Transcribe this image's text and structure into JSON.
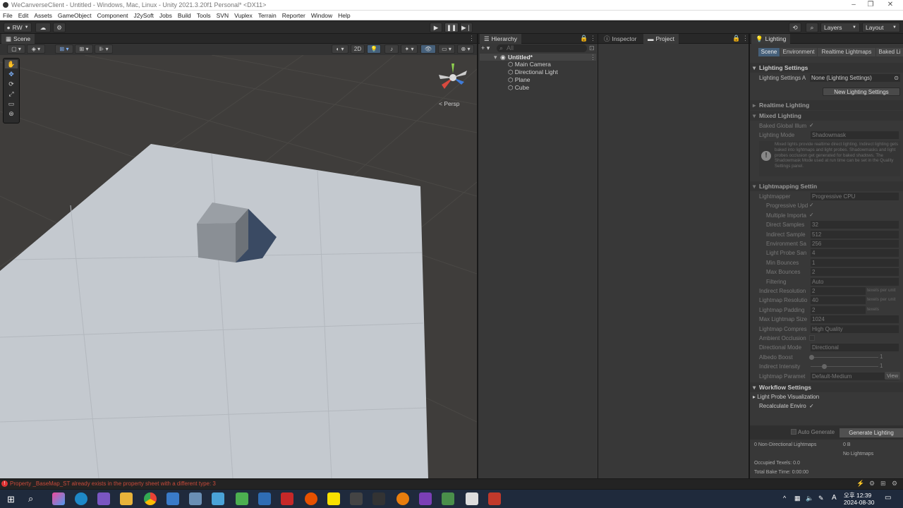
{
  "window": {
    "title": "WeCanverseClient - Untitled - Windows, Mac, Linux - Unity 2021.3.20f1 Personal* <DX11>"
  },
  "menu": [
    "File",
    "Edit",
    "Assets",
    "GameObject",
    "Component",
    "J2ySoft",
    "Jobs",
    "Build",
    "Tools",
    "SVN",
    "Vuplex",
    "Terrain",
    "Reporter",
    "Window",
    "Help"
  ],
  "toolbar": {
    "account": "RW",
    "layers": "Layers",
    "layout": "Layout"
  },
  "scene": {
    "tab": "Scene",
    "btn_2d": "2D",
    "persp": "Persp"
  },
  "hierarchy": {
    "tab": "Hierarchy",
    "search_placeholder": "All",
    "root": "Untitled*",
    "items": [
      "Main Camera",
      "Directional Light",
      "Plane",
      "Cube"
    ]
  },
  "inspector": {
    "tab": "Inspector",
    "project_tab": "Project"
  },
  "lighting": {
    "tab": "Lighting",
    "subtabs": [
      "Scene",
      "Environment",
      "Realtime Lightmaps",
      "Baked Li"
    ],
    "lighting_settings_header": "Lighting Settings",
    "lighting_settings_asset_label": "Lighting Settings A",
    "lighting_settings_asset_value": "None (Lighting Settings)",
    "new_button": "New Lighting Settings",
    "realtime_header": "Realtime Lighting",
    "mixed_header": "Mixed Lighting",
    "baked_gi_label": "Baked Global Illum",
    "check": "✓",
    "lighting_mode_label": "Lighting Mode",
    "lighting_mode_value": "Shadowmask",
    "info_text": "Mixed lights provide realtime direct lighting. Indirect lighting gets baked into lightmaps and light probes. Shadowmasks and light probes occlusion get generated for baked shadows. The Shadowmask Mode used at run time can be set in the Quality Settings panel.",
    "lightmapping_header": "Lightmapping Settin",
    "rows": [
      {
        "label": "Lightmapper",
        "value": "Progressive CPU",
        "ind": false
      },
      {
        "label": "Progressive Upd",
        "value": "✓",
        "ind": true
      },
      {
        "label": "Multiple Importa",
        "value": "✓",
        "ind": true
      },
      {
        "label": "Direct Samples",
        "value": "32",
        "ind": true
      },
      {
        "label": "Indirect Sample",
        "value": "512",
        "ind": true
      },
      {
        "label": "Environment Sa",
        "value": "256",
        "ind": true
      },
      {
        "label": "Light Probe San",
        "value": "4",
        "ind": true
      },
      {
        "label": "Min Bounces",
        "value": "1",
        "ind": true
      },
      {
        "label": "Max Bounces",
        "value": "2",
        "ind": true
      },
      {
        "label": "Filtering",
        "value": "Auto",
        "ind": true
      },
      {
        "label": "Indirect Resolution",
        "value": "2",
        "ind": false,
        "unit": "texels per unit"
      },
      {
        "label": "Lightmap Resolutio",
        "value": "40",
        "ind": false,
        "unit": "texels per unit"
      },
      {
        "label": "Lightmap Padding",
        "value": "2",
        "ind": false,
        "unit": "texels"
      },
      {
        "label": "Max Lightmap Size",
        "value": "1024",
        "ind": false
      },
      {
        "label": "Lightmap Compres",
        "value": "High Quality",
        "ind": false
      },
      {
        "label": "Ambient Occlusion",
        "value": "",
        "ind": false
      },
      {
        "label": "Directional Mode",
        "value": "Directional",
        "ind": false
      },
      {
        "label": "Albedo Boost",
        "value": "1",
        "ind": false
      },
      {
        "label": "Indirect Intensity",
        "value": "1",
        "ind": false
      },
      {
        "label": "Lightmap Paramet",
        "value": "Default-Medium",
        "ind": false
      }
    ],
    "view_button": "View",
    "workflow_header": "Workflow Settings",
    "light_probe_vis": "Light Probe Visualization",
    "recalc_env": "Recalculate Enviro",
    "auto_generate": "Auto Generate",
    "generate_button": "Generate Lighting",
    "stats": [
      {
        "label": "0 Non-Directional Lightmaps",
        "value": "0 B"
      },
      {
        "label": "",
        "value": "No Lightmaps"
      },
      {
        "label": "Occupied Texels: 0.0",
        "value": ""
      },
      {
        "label": "Total Bake Time: 0:00:00",
        "value": ""
      }
    ]
  },
  "status": {
    "error": "Property _BaseMap_ST already exists in the property sheet with a different type: 3"
  },
  "taskbar": {
    "time": "오후 12:39",
    "date": "2024-08-30",
    "lang": "A"
  }
}
